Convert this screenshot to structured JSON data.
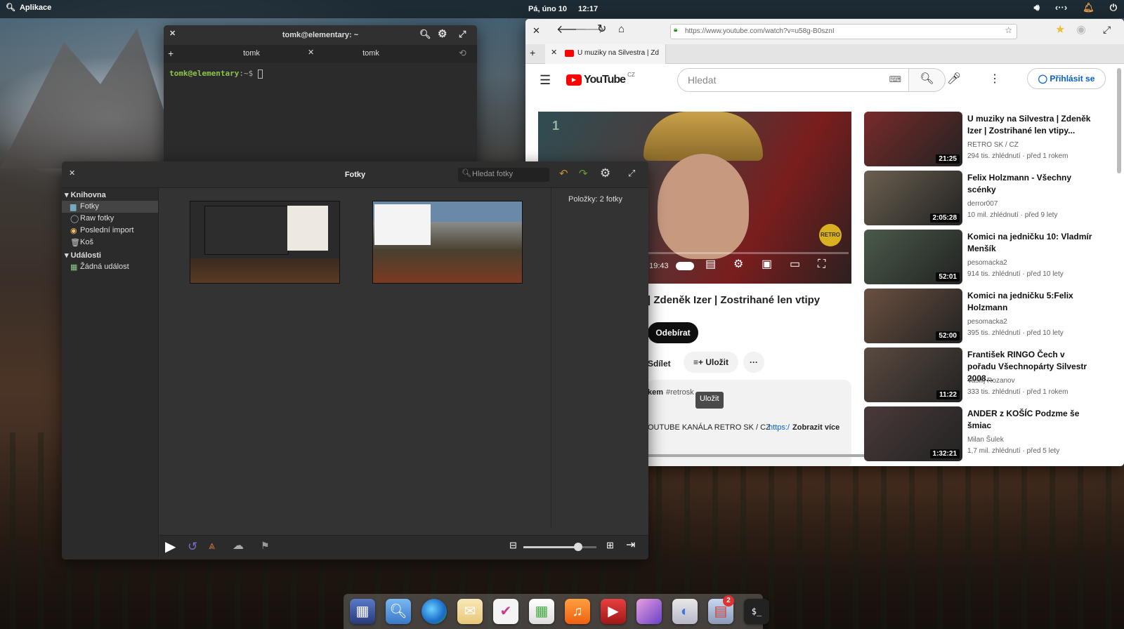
{
  "panel": {
    "apps_label": "Aplikace",
    "date": "Pá, úno 10",
    "time": "12:17"
  },
  "terminal": {
    "title": "tomk@elementary: ~",
    "tabs": [
      "tomk",
      "tomk"
    ],
    "prompt_user": "tomk@elementary",
    "prompt_path": ":~$"
  },
  "photos": {
    "title": "Fotky",
    "search_placeholder": "Hledat fotky",
    "sidebar": {
      "library": "Knihovna",
      "items": [
        "Fotky",
        "Raw fotky",
        "Poslední import",
        "Koš"
      ],
      "events": "Události",
      "event_items": [
        "Žádná událost"
      ]
    },
    "info_label": "Položky:",
    "info_value": "2 fotky"
  },
  "browser": {
    "url": "https://www.youtube.com/watch?v=u58g-B0sznI",
    "tab_title": "U muziky na Silvestra | Zd",
    "yt": {
      "logo": "YouTube",
      "region": "CZ",
      "search_placeholder": "Hledat",
      "signin": "Přihlásit se",
      "video_title": "| Zdeněk Izer | Zostrihané len vtipy",
      "time": "/ 19:43",
      "subscribe": "Odebírat",
      "share": "Sdílet",
      "save": "Uložit",
      "more": "···",
      "tooltip": "Uložit",
      "desc_prefix": "kem",
      "desc_hashtag": "#retrosk",
      "desc_text": "OUTUBE KANÁLA RETRO SK / CZ",
      "desc_link": "https:/",
      "show_more": "Zobrazit více",
      "channel_badge": "RETRO",
      "recs": [
        {
          "title": "U muziky na Silvestra | Zdeněk Izer | Zostrihané len vtipy...",
          "channel": "RETRO SK / CZ",
          "views": "294 tis. zhlédnutí",
          "age": "před 1 rokem",
          "duration": "21:25"
        },
        {
          "title": "Felix Holzmann - Všechny scénky",
          "channel": "derror007",
          "views": "10 mil. zhlédnutí",
          "age": "před 9 lety",
          "duration": "2:05:28"
        },
        {
          "title": "Komici na jedničku 10: Vladmír Menšík",
          "channel": "pesomacka2",
          "views": "914 tis. zhlédnutí",
          "age": "před 10 lety",
          "duration": "52:01"
        },
        {
          "title": "Komici na jedničku 5:Felix Holzmann",
          "channel": "pesomacka2",
          "views": "395 tis. zhlédnutí",
          "age": "před 10 lety",
          "duration": "52:00"
        },
        {
          "title": "František RINGO Čech v pořadu Všechnopárty Silvestr 2008...",
          "channel": "Vasilij Rozanov",
          "views": "333 tis. zhlédnutí",
          "age": "před 1 rokem",
          "duration": "11:22"
        },
        {
          "title": "ANDER z KOŠÍC Podzme še šmiac",
          "channel": "Milan Šulek",
          "views": "1,7 mil. zhlédnutí",
          "age": "před 5 lety",
          "duration": "1:32:21"
        }
      ]
    }
  },
  "dock": {
    "badge": "2",
    "terminal_glyph": "$_"
  }
}
